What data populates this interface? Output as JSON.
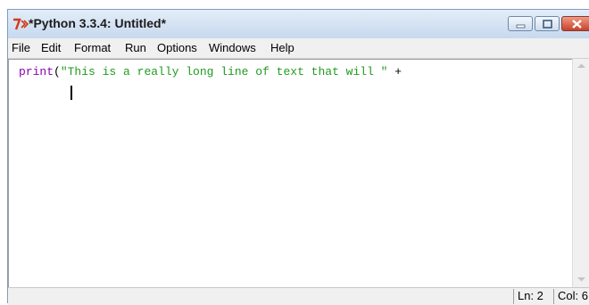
{
  "window": {
    "title": "*Python 3.3.4: Untitled*",
    "icon": "python-idle-icon",
    "icon_color": "#d23a1a"
  },
  "menubar": {
    "items": [
      "File",
      "Edit",
      "Format",
      "Run",
      "Options",
      "Windows",
      "Help"
    ]
  },
  "editor": {
    "keyword": "print",
    "open_paren": "(",
    "string_literal": "\"This is a really long line of text that will \"",
    "operator": " +",
    "colors": {
      "keyword": "#8b00b2",
      "string": "#1f9b1f"
    }
  },
  "statusbar": {
    "line": "Ln: 2",
    "col": "Col: 6"
  }
}
